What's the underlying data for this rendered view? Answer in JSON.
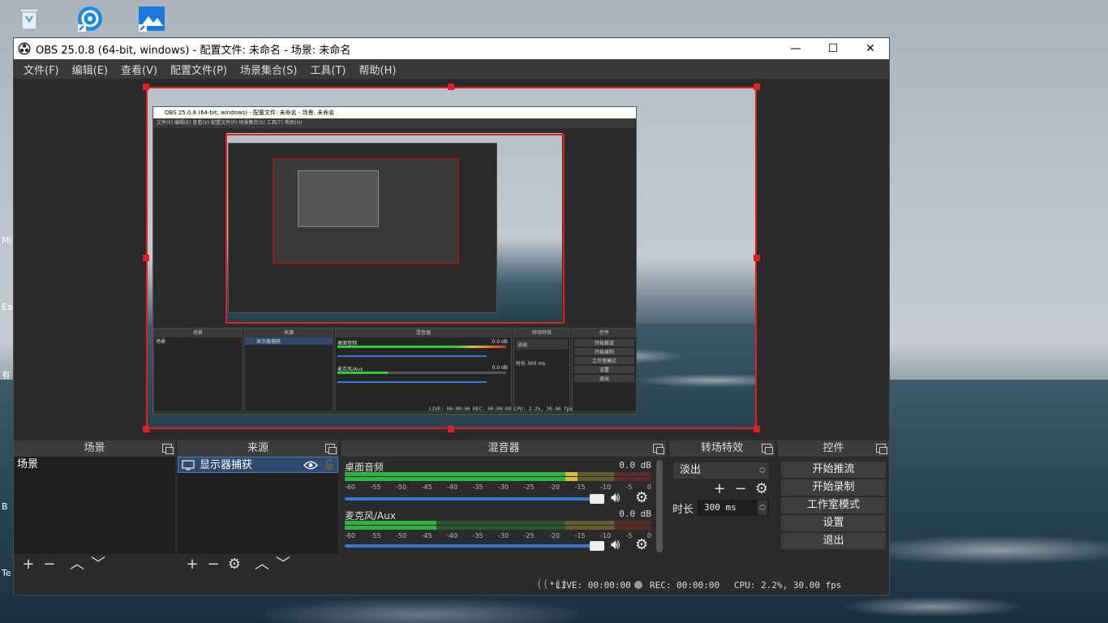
{
  "window": {
    "title": "OBS 25.0.8 (64-bit, windows) - 配置文件: 未命名 - 场景: 未命名",
    "minimize": "—",
    "maximize": "☐",
    "close": "✕"
  },
  "menu": [
    "文件(F)",
    "编辑(E)",
    "查看(V)",
    "配置文件(P)",
    "场景集合(S)",
    "工具(T)",
    "帮助(H)"
  ],
  "desktop": {
    "side_texts": [
      "Mi",
      "Ea",
      "有",
      "B",
      "Te"
    ]
  },
  "nested": {
    "title": "OBS 25.0.8 (64-bit, windows) - 配置文件: 未命名 - 场景: 未命名",
    "menu": "文件(F)  编辑(E)  查看(V)  配置文件(P)  场景集合(S)  工具(T)  帮助(H)",
    "docks": [
      "场景",
      "来源",
      "混音器",
      "转场特效",
      "控件"
    ],
    "scene_item": "场景",
    "source_item": "显示器捕获",
    "track1": "桌面音频",
    "track2": "麦克风/Aux",
    "db": "0.0 dB",
    "transition": "淡出",
    "duration_label": "时长",
    "duration": "300 ms",
    "controls": [
      "开始推流",
      "开始录制",
      "工作室模式",
      "设置",
      "退出"
    ],
    "status": "LIVE: 00:00:00   REC: 00:00:00   CPU: 2.2%, 30.00 fps"
  },
  "scenes": {
    "header": "场景",
    "items": [
      "场景"
    ]
  },
  "sources": {
    "header": "来源",
    "items": [
      {
        "label": "显示器捕获",
        "visible": true,
        "locked": false
      }
    ]
  },
  "mixer": {
    "header": "混音器",
    "tracks": [
      {
        "name": "桌面音频",
        "db": "0.0 dB",
        "level": 0.76,
        "volume": 1.0
      },
      {
        "name": "麦克风/Aux",
        "db": "0.0 dB",
        "level": 0.3,
        "volume": 1.0
      }
    ],
    "ticks": [
      "-60",
      "-55",
      "-50",
      "-45",
      "-40",
      "-35",
      "-30",
      "-25",
      "-20",
      "-15",
      "-10",
      "-5",
      "0"
    ]
  },
  "transitions": {
    "header": "转场特效",
    "selected": "淡出",
    "duration_label": "时长",
    "duration": "300 ms"
  },
  "controls": {
    "header": "控件",
    "buttons": [
      "开始推流",
      "开始录制",
      "工作室模式",
      "设置",
      "退出"
    ]
  },
  "status": {
    "live": "LIVE: 00:00:00",
    "rec": "REC: 00:00:00",
    "cpu": "CPU: 2.2%, 30.00 fps"
  },
  "colors": {
    "accent_red": "#e02020",
    "slider_blue": "#2f7ad6",
    "meter_green": "#2ecc40",
    "meter_yellow": "#e8d83a",
    "meter_red": "#d02a2a"
  }
}
